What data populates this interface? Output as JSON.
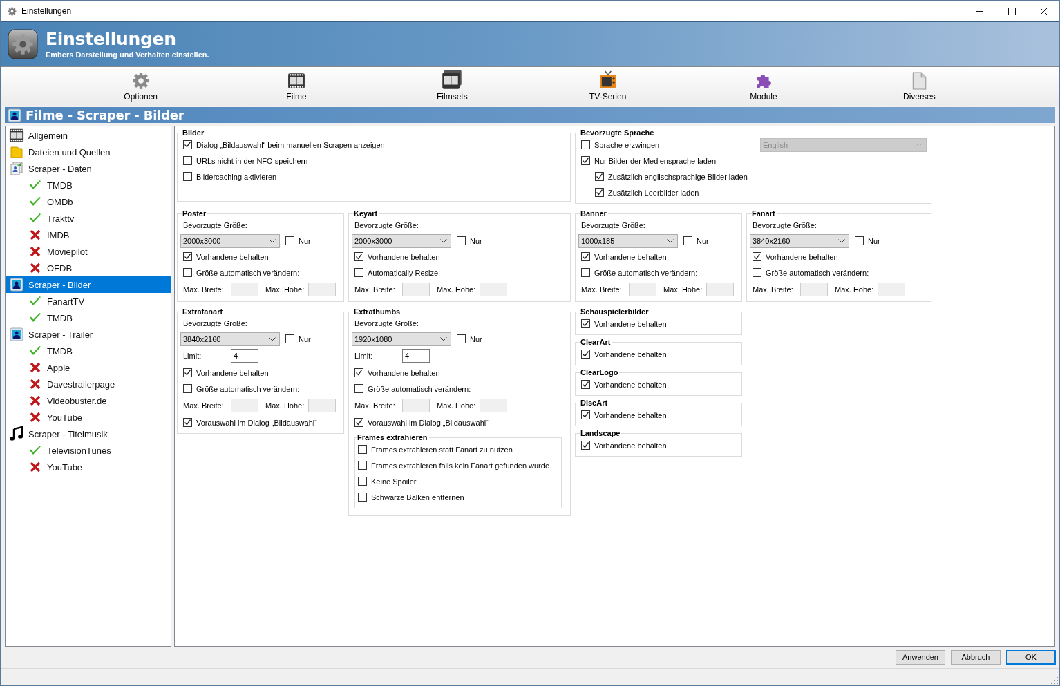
{
  "window": {
    "title": "Einstellungen"
  },
  "header": {
    "title": "Einstellungen",
    "subtitle": "Embers Darstellung und Verhalten einstellen."
  },
  "toolbar": [
    {
      "label": "Optionen",
      "kind": "gear"
    },
    {
      "label": "Filme",
      "kind": "film"
    },
    {
      "label": "Filmsets",
      "kind": "filmset"
    },
    {
      "label": "TV-Serien",
      "kind": "tv"
    },
    {
      "label": "Module",
      "kind": "puzzle"
    },
    {
      "label": "Diverses",
      "kind": "document"
    }
  ],
  "section_title": "Filme - Scraper - Bilder",
  "sidebar": {
    "items": [
      {
        "label": "Allgemein",
        "kind": "film",
        "selected": false
      },
      {
        "label": "Dateien und Quellen",
        "kind": "folder",
        "selected": false
      },
      {
        "label": "Scraper - Daten",
        "kind": "data",
        "selected": false,
        "children": [
          {
            "label": "TMDB",
            "enabled": true,
            "selected": false
          },
          {
            "label": "OMDb",
            "enabled": true,
            "selected": false
          },
          {
            "label": "Trakttv",
            "enabled": true,
            "selected": false
          },
          {
            "label": "IMDB",
            "enabled": false,
            "selected": false
          },
          {
            "label": "Moviepilot",
            "enabled": false,
            "selected": false
          },
          {
            "label": "OFDB",
            "enabled": false,
            "selected": false
          }
        ]
      },
      {
        "label": "Scraper - Bilder",
        "kind": "picture",
        "selected": true,
        "children": [
          {
            "label": "FanartTV",
            "enabled": true,
            "selected": false
          },
          {
            "label": "TMDB",
            "enabled": true,
            "selected": false
          }
        ]
      },
      {
        "label": "Scraper - Trailer",
        "kind": "picture",
        "selected": false,
        "children": [
          {
            "label": "TMDB",
            "enabled": true,
            "selected": false
          },
          {
            "label": "Apple",
            "enabled": false,
            "selected": false
          },
          {
            "label": "Davestrailerpage",
            "enabled": false,
            "selected": false
          },
          {
            "label": "Videobuster.de",
            "enabled": false,
            "selected": false
          },
          {
            "label": "YouTube",
            "enabled": false,
            "selected": false
          }
        ]
      },
      {
        "label": "Scraper - Titelmusik",
        "kind": "music",
        "selected": false,
        "children": [
          {
            "label": "TelevisionTunes",
            "enabled": true,
            "selected": false
          },
          {
            "label": "YouTube",
            "enabled": false,
            "selected": false
          }
        ]
      }
    ]
  },
  "rows": [
    [
      [
        {
          "title": "Bilder",
          "items": [
            {
              "kind": "check",
              "label": "Dialog „Bildauswahl“ beim manuellen Scrapen anzeigen",
              "checked": true
            },
            {
              "kind": "check",
              "label": "URLs nicht in der NFO speichern",
              "checked": false
            },
            {
              "kind": "check",
              "label": "Bildercaching aktivieren",
              "checked": false
            }
          ]
        }
      ],
      [
        {
          "title": "Bevorzugte Sprache",
          "items": [
            {
              "kind": "check_select",
              "label": "Sprache erzwingen",
              "checked": false,
              "select": {
                "value": "English",
                "disabled": true
              }
            },
            {
              "kind": "check",
              "label": "Nur Bilder der Mediensprache laden",
              "checked": true,
              "children": [
                {
                  "kind": "check",
                  "label": "Zusätzlich englischsprachige Bilder laden",
                  "checked": true
                },
                {
                  "kind": "check",
                  "label": "Zusätzlich Leerbilder laden",
                  "checked": true
                }
              ]
            }
          ]
        }
      ]
    ],
    [
      [
        {
          "title": "Poster",
          "items": [
            {
              "kind": "text",
              "label": "Bevorzugte Größe:"
            },
            {
              "kind": "size",
              "value": "2000x3000",
              "check_label": "Nur",
              "checked": false
            },
            {
              "kind": "check",
              "label": "Vorhandene behalten",
              "checked": true
            },
            {
              "kind": "check",
              "label": "Größe automatisch verändern:",
              "checked": false
            },
            {
              "kind": "maxsize",
              "width_label": "Max. Breite:",
              "height_label": "Max. Höhe:",
              "disabled": true
            }
          ]
        }
      ],
      [
        {
          "title": "Keyart",
          "items": [
            {
              "kind": "text",
              "label": "Bevorzugte Größe:"
            },
            {
              "kind": "size",
              "value": "2000x3000",
              "check_label": "Nur",
              "checked": false
            },
            {
              "kind": "check",
              "label": "Vorhandene behalten",
              "checked": true
            },
            {
              "kind": "check",
              "label": "Automatically Resize:",
              "checked": false
            },
            {
              "kind": "maxsize",
              "width_label": "Max. Breite:",
              "height_label": "Max. Höhe:",
              "disabled": true
            }
          ]
        }
      ],
      [
        {
          "title": "Banner",
          "items": [
            {
              "kind": "text",
              "label": "Bevorzugte Größe:"
            },
            {
              "kind": "size",
              "value": "1000x185",
              "check_label": "Nur",
              "checked": false
            },
            {
              "kind": "check",
              "label": "Vorhandene behalten",
              "checked": true
            },
            {
              "kind": "check",
              "label": "Größe automatisch verändern:",
              "checked": false
            },
            {
              "kind": "maxsize",
              "width_label": "Max. Breite:",
              "height_label": "Max. Höhe:",
              "disabled": true
            }
          ]
        }
      ],
      [
        {
          "title": "Fanart",
          "items": [
            {
              "kind": "text",
              "label": "Bevorzugte Größe:"
            },
            {
              "kind": "size",
              "value": "3840x2160",
              "check_label": "Nur",
              "checked": false
            },
            {
              "kind": "check",
              "label": "Vorhandene behalten",
              "checked": true
            },
            {
              "kind": "check",
              "label": "Größe automatisch verändern:",
              "checked": false
            },
            {
              "kind": "maxsize",
              "width_label": "Max. Breite:",
              "height_label": "Max. Höhe:",
              "disabled": true
            }
          ]
        }
      ]
    ],
    [
      [
        {
          "title": "Extrafanart",
          "items": [
            {
              "kind": "text",
              "label": "Bevorzugte Größe:"
            },
            {
              "kind": "size",
              "value": "3840x2160",
              "check_label": "Nur",
              "checked": false
            },
            {
              "kind": "limit",
              "label": "Limit:",
              "value": "4"
            },
            {
              "kind": "check",
              "label": "Vorhandene behalten",
              "checked": true
            },
            {
              "kind": "check",
              "label": "Größe automatisch verändern:",
              "checked": false
            },
            {
              "kind": "maxsize",
              "width_label": "Max. Breite:",
              "height_label": "Max. Höhe:",
              "disabled": true
            },
            {
              "kind": "check",
              "label": "Vorauswahl im Dialog „Bildauswahl“",
              "checked": true
            }
          ]
        }
      ],
      [
        {
          "title": "Extrathumbs",
          "items": [
            {
              "kind": "text",
              "label": "Bevorzugte Größe:"
            },
            {
              "kind": "size",
              "value": "1920x1080",
              "check_label": "Nur",
              "checked": false
            },
            {
              "kind": "limit",
              "label": "Limit:",
              "value": "4"
            },
            {
              "kind": "check",
              "label": "Vorhandene behalten",
              "checked": true
            },
            {
              "kind": "check",
              "label": "Größe automatisch verändern:",
              "checked": false
            },
            {
              "kind": "maxsize",
              "width_label": "Max. Breite:",
              "height_label": "Max. Höhe:",
              "disabled": true
            },
            {
              "kind": "check",
              "label": "Vorauswahl im Dialog „Bildauswahl“",
              "checked": true
            },
            {
              "kind": "group",
              "title": "Frames extrahieren",
              "items": [
                {
                  "kind": "check",
                  "label": "Frames extrahieren statt Fanart zu nutzen",
                  "checked": false
                },
                {
                  "kind": "check",
                  "label": "Frames extrahieren falls kein Fanart gefunden wurde",
                  "checked": false
                },
                {
                  "kind": "check",
                  "label": "Keine Spoiler",
                  "checked": false
                },
                {
                  "kind": "check",
                  "label": "Schwarze Balken entfernen",
                  "checked": false
                }
              ]
            }
          ]
        }
      ],
      [
        {
          "title": "Schauspielerbilder",
          "items": [
            {
              "kind": "check",
              "label": "Vorhandene behalten",
              "checked": true
            }
          ]
        },
        {
          "title": "ClearArt",
          "items": [
            {
              "kind": "check",
              "label": "Vorhandene behalten",
              "checked": true
            }
          ]
        },
        {
          "title": "ClearLogo",
          "items": [
            {
              "kind": "check",
              "label": "Vorhandene behalten",
              "checked": true
            }
          ]
        },
        {
          "title": "DiscArt",
          "items": [
            {
              "kind": "check",
              "label": "Vorhandene behalten",
              "checked": true
            }
          ]
        },
        {
          "title": "Landscape",
          "items": [
            {
              "kind": "check",
              "label": "Vorhandene behalten",
              "checked": true
            }
          ]
        }
      ]
    ]
  ],
  "buttons": [
    {
      "label": "Anwenden",
      "default": false
    },
    {
      "label": "Abbruch",
      "default": false
    },
    {
      "label": "OK",
      "default": true
    }
  ]
}
